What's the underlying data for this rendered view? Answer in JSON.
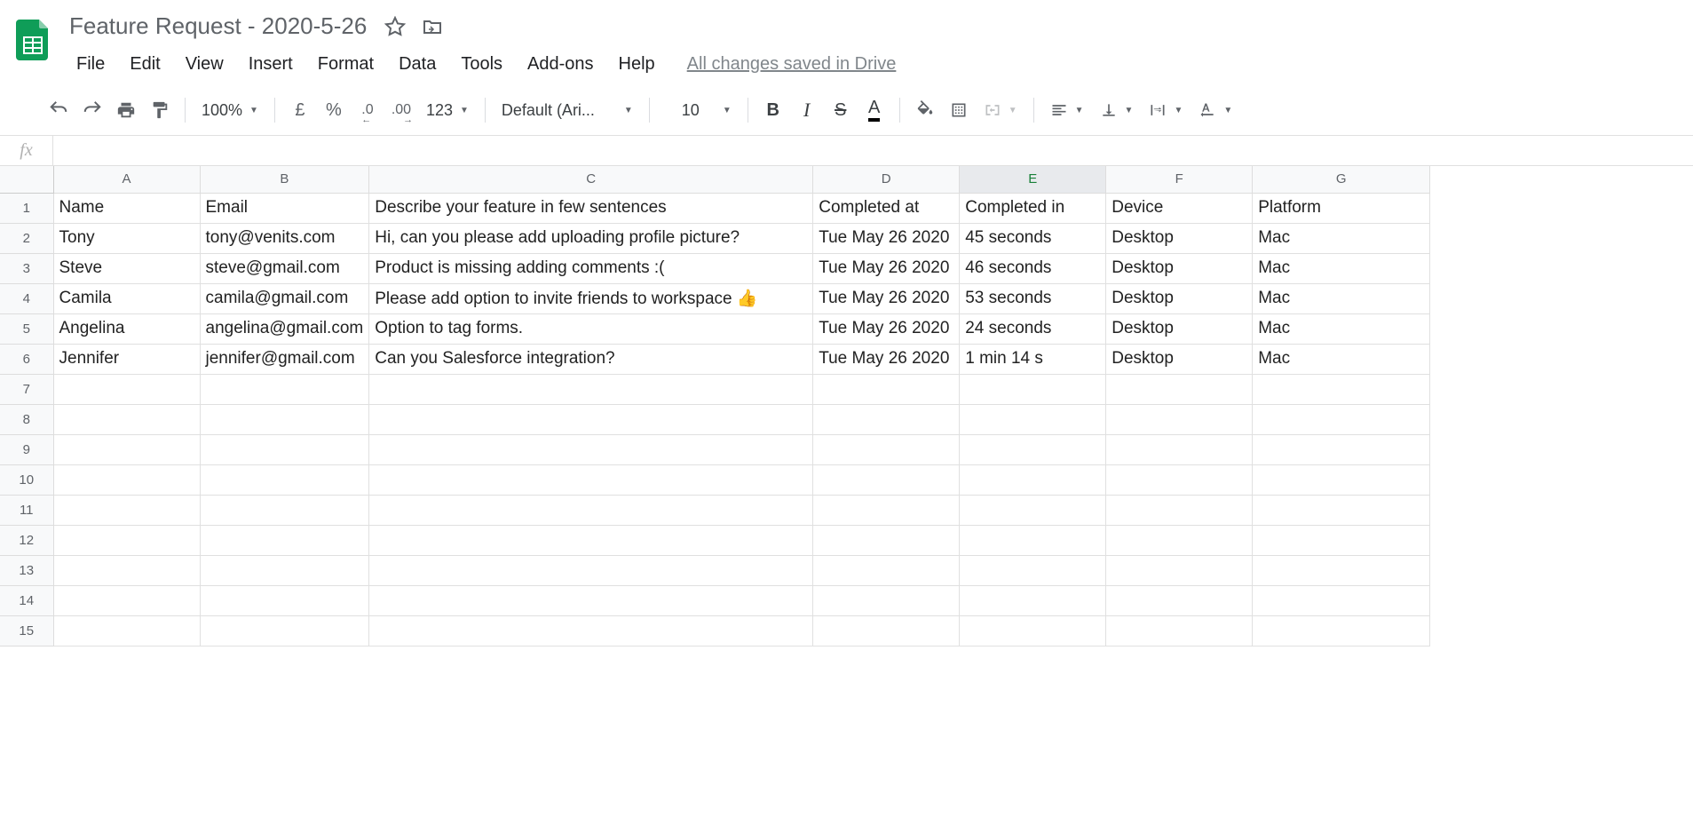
{
  "doc": {
    "title": "Feature Request - 2020-5-26",
    "save_status": "All changes saved in Drive"
  },
  "menu": {
    "file": "File",
    "edit": "Edit",
    "view": "View",
    "insert": "Insert",
    "format": "Format",
    "data": "Data",
    "tools": "Tools",
    "addons": "Add-ons",
    "help": "Help"
  },
  "toolbar": {
    "zoom": "100%",
    "currency": "£",
    "percent": "%",
    "dec_less": ".0",
    "dec_more": ".00",
    "num_format": "123",
    "font": "Default (Ari...",
    "font_size": "10"
  },
  "formula": {
    "fx": "fx",
    "value": ""
  },
  "columns": [
    "A",
    "B",
    "C",
    "D",
    "E",
    "F",
    "G"
  ],
  "col_widths": [
    "col-A",
    "col-B",
    "col-C",
    "col-D",
    "col-E",
    "col-F",
    "col-G"
  ],
  "selected_col": "E",
  "rows": [
    {
      "n": "1",
      "cells": [
        "Name",
        "Email",
        "Describe your feature in few sentences",
        "Completed at",
        "Completed in",
        "Device",
        "Platform"
      ]
    },
    {
      "n": "2",
      "cells": [
        "Tony",
        "tony@venits.com",
        "Hi, can you please add uploading profile picture?",
        "Tue May 26 2020",
        "45 seconds",
        "Desktop",
        "Mac"
      ]
    },
    {
      "n": "3",
      "cells": [
        "Steve",
        "steve@gmail.com",
        "Product is missing adding comments :(",
        "Tue May 26 2020",
        "46 seconds",
        "Desktop",
        "Mac"
      ]
    },
    {
      "n": "4",
      "cells": [
        "Camila",
        "camila@gmail.com",
        "Please add option to invite friends to workspace 👍",
        "Tue May 26 2020",
        "53 seconds",
        "Desktop",
        "Mac"
      ]
    },
    {
      "n": "5",
      "cells": [
        "Angelina",
        "angelina@gmail.com",
        "Option to tag forms.",
        "Tue May 26 2020",
        "24 seconds",
        "Desktop",
        "Mac"
      ]
    },
    {
      "n": "6",
      "cells": [
        "Jennifer",
        "jennifer@gmail.com",
        "Can you Salesforce integration?",
        "Tue May 26 2020",
        "1 min 14 s",
        "Desktop",
        "Mac"
      ]
    },
    {
      "n": "7",
      "cells": [
        "",
        "",
        "",
        "",
        "",
        "",
        ""
      ]
    },
    {
      "n": "8",
      "cells": [
        "",
        "",
        "",
        "",
        "",
        "",
        ""
      ]
    },
    {
      "n": "9",
      "cells": [
        "",
        "",
        "",
        "",
        "",
        "",
        ""
      ]
    },
    {
      "n": "10",
      "cells": [
        "",
        "",
        "",
        "",
        "",
        "",
        ""
      ]
    },
    {
      "n": "11",
      "cells": [
        "",
        "",
        "",
        "",
        "",
        "",
        ""
      ]
    },
    {
      "n": "12",
      "cells": [
        "",
        "",
        "",
        "",
        "",
        "",
        ""
      ]
    },
    {
      "n": "13",
      "cells": [
        "",
        "",
        "",
        "",
        "",
        "",
        ""
      ]
    },
    {
      "n": "14",
      "cells": [
        "",
        "",
        "",
        "",
        "",
        "",
        ""
      ]
    },
    {
      "n": "15",
      "cells": [
        "",
        "",
        "",
        "",
        "",
        "",
        ""
      ]
    }
  ]
}
